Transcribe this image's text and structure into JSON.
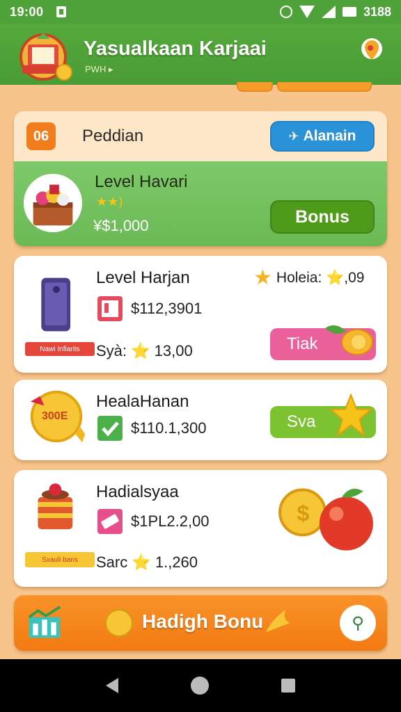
{
  "status_bar": {
    "time": "19:00",
    "battery_text": "3188"
  },
  "header": {
    "title": "Yasualkaan Karjaai",
    "subtitle": "PWH ▸"
  },
  "top_card": {
    "badge": "06",
    "label": "Peddian",
    "action_label": "Alanain",
    "level_title": "Level Havari",
    "stars": "★★)",
    "price": "¥$1,000",
    "bonus_label": "Bonus"
  },
  "items": [
    {
      "title": "Level Harjan",
      "price": "$112,3901",
      "secondary": "Syà: ⭐ 13,00",
      "tag": "Holeia: ⭐,09",
      "ribbon": "Nawi Infiarits",
      "button": "Tiak",
      "button_color": "#e9609a"
    },
    {
      "title": "HealaHanan",
      "price": "$110.1,300",
      "badge_text": "300E",
      "button": "Sva",
      "button_color": "#7cc231"
    },
    {
      "title": "Hadialsyaa",
      "price": "$1PL2.2,00",
      "secondary": "Sarc ⭐ 1.,260",
      "ribbon": "Sxauli bans"
    }
  ],
  "bottom_bar": {
    "label": "Hadigh Bonu"
  },
  "colors": {
    "header_green": "#4fa23a",
    "background": "#f6c48c",
    "accent_orange": "#f27a12",
    "blue_button": "#2a93d8",
    "bonus_green": "#4e9b1b"
  }
}
